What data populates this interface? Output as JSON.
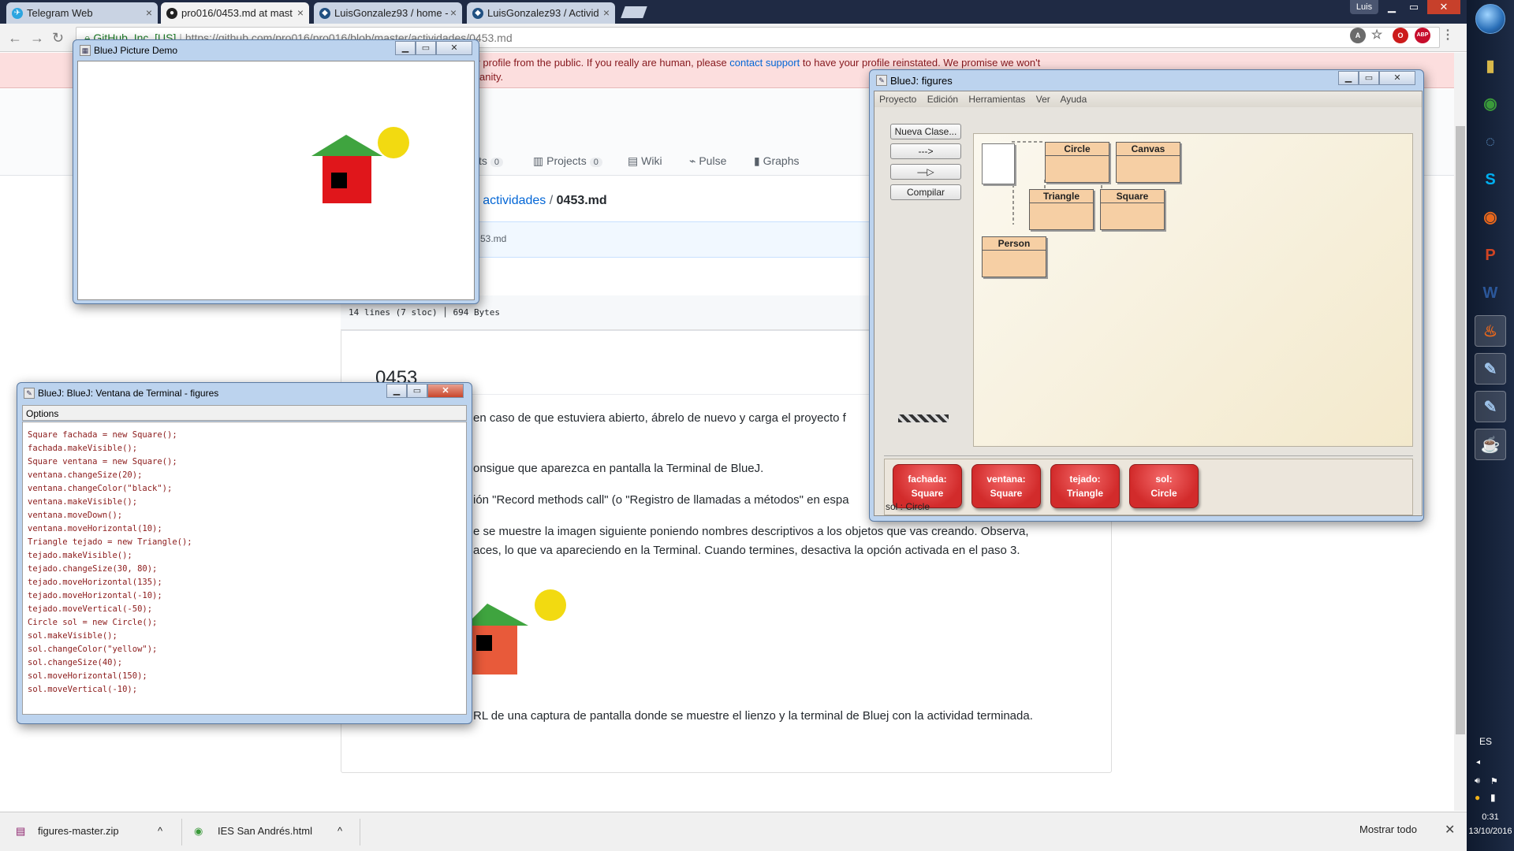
{
  "browser": {
    "tabs": [
      {
        "label": "Telegram Web",
        "color": "#2ca5e0",
        "glyph": "✈"
      },
      {
        "label": "pro016/0453.md at mast",
        "color": "#222222",
        "glyph": "●"
      },
      {
        "label": "LuisGonzalez93 / home -",
        "color": "#205081",
        "glyph": "◆"
      },
      {
        "label": "LuisGonzalez93 / Activid",
        "color": "#205081",
        "glyph": "◆"
      }
    ],
    "profile_name": "Luis",
    "url_green": "GitHub, Inc. [US]",
    "url_rest": "https://github.com/pro016/pro016/blob/master/actividades/0453.md",
    "extensions": [
      {
        "name": "translate-icon",
        "text": "A",
        "color": "#6b6b6b"
      },
      {
        "name": "star-icon",
        "text": "☆",
        "color": "#777777"
      },
      {
        "name": "opera-icon",
        "text": "O",
        "color": "#cc1b1b"
      },
      {
        "name": "adblock-icon",
        "text": "ABP",
        "color": "#c70d2c"
      },
      {
        "name": "menu-icon",
        "text": "⋮",
        "color": "#777777"
      }
    ]
  },
  "github": {
    "flash_line1_a": "our profile from the public. If you really are human, please",
    "flash_link": "contact support",
    "flash_line1_b": "to have your profile reinstated. We promise we won't",
    "flash_line2": "umanity.",
    "nav": [
      {
        "label": "sts",
        "count": "0"
      },
      {
        "label": "Projects",
        "count": "0"
      },
      {
        "label": "Wiki",
        "count": ""
      },
      {
        "label": "Pulse",
        "count": ""
      },
      {
        "label": "Graphs",
        "count": ""
      }
    ],
    "breadcrumb_a": "6",
    "breadcrumb_b": "actividades",
    "breadcrumb_file": "0453.md",
    "commit_text": "53.md",
    "file_info": "14 lines (7 sloc)  │  694 Bytes",
    "md_title": "0453",
    "md_lines": [
      "en caso de que estuviera abierto, ábrelo de nuevo y carga el proyecto  f",
      "onsigue que aparezca en pantalla la Terminal de BlueJ.",
      "ión \"Record methods call\" (o \"Registro de llamadas a métodos\" en espa",
      "e se muestre la imagen siguiente poniendo nombres descriptivos a los objetos que vas creando. Observa,",
      "aces, lo que va apareciendo en la Terminal. Cuando termines, desactiva la opción activada en el paso 3.",
      "RL de una captura de pantalla donde se muestre el lienzo y la terminal de Bluej con la actividad terminada."
    ]
  },
  "downloads": {
    "items": [
      "figures-master.zip",
      "IES San Andrés.html"
    ],
    "show_all": "Mostrar todo",
    "close": "✕"
  },
  "taskbar": {
    "icons": [
      {
        "name": "explorer-icon",
        "glyph": "▮",
        "color": "#d8b84a"
      },
      {
        "name": "chrome-icon",
        "glyph": "◉",
        "color": "#3a9a3a"
      },
      {
        "name": "steam-icon",
        "glyph": "◌",
        "color": "#2a4a6a"
      },
      {
        "name": "skype-icon",
        "glyph": "S",
        "color": "#00aff0"
      },
      {
        "name": "firefox-icon",
        "glyph": "◉",
        "color": "#e8671c"
      },
      {
        "name": "powerpoint-icon",
        "glyph": "P",
        "color": "#d04423"
      },
      {
        "name": "word-icon",
        "glyph": "W",
        "color": "#2b579a"
      },
      {
        "name": "flame-icon",
        "glyph": "♨",
        "color": "#e8671c"
      },
      {
        "name": "bluej-icon",
        "glyph": "✎",
        "color": "#3d5a80"
      },
      {
        "name": "bluej-icon",
        "glyph": "✎",
        "color": "#3d5a80"
      },
      {
        "name": "java-icon",
        "glyph": "☕",
        "color": "#e3e3e3"
      }
    ],
    "lang": "ES",
    "time": "0:31",
    "date": "13/10/2016"
  },
  "picture_demo": {
    "title": "BlueJ Picture Demo",
    "colors": {
      "wall": "#e0161b",
      "window": "#000000",
      "roof": "#3fa43f",
      "sun": "#f2da11"
    }
  },
  "terminal": {
    "title": "BlueJ: BlueJ:  Ventana de Terminal - figures",
    "menu": "Options",
    "lines": [
      "Square fachada = new Square();",
      "fachada.makeVisible();",
      "Square ventana = new Square();",
      "ventana.changeSize(20);",
      "ventana.changeColor(\"black\");",
      "ventana.makeVisible();",
      "ventana.moveDown();",
      "ventana.moveHorizontal(10);",
      "Triangle tejado = new Triangle();",
      "tejado.makeVisible();",
      "tejado.changeSize(30, 80);",
      "tejado.moveHorizontal(135);",
      "tejado.moveHorizontal(-10);",
      "tejado.moveVertical(-50);",
      "Circle sol = new Circle();",
      "sol.makeVisible();",
      "sol.changeColor(\"yellow\");",
      "sol.changeSize(40);",
      "sol.moveHorizontal(150);",
      "sol.moveVertical(-10);"
    ]
  },
  "bluej": {
    "title": "BlueJ:  figures",
    "menu": [
      "Proyecto",
      "Edición",
      "Herramientas",
      "Ver",
      "Ayuda"
    ],
    "tools": [
      "Nueva Clase...",
      "--->",
      "—▷",
      "Compilar"
    ],
    "classes": [
      "Circle",
      "Canvas",
      "Triangle",
      "Square",
      "Person"
    ],
    "objects": [
      {
        "name": "fachada:",
        "type": "Square"
      },
      {
        "name": "ventana:",
        "type": "Square"
      },
      {
        "name": "tejado:",
        "type": "Triangle"
      },
      {
        "name": "sol:",
        "type": "Circle"
      }
    ],
    "status": "sol : Circle"
  },
  "caption_buttons": {
    "minimize": "▁",
    "maximize": "▭",
    "close": "✕"
  }
}
